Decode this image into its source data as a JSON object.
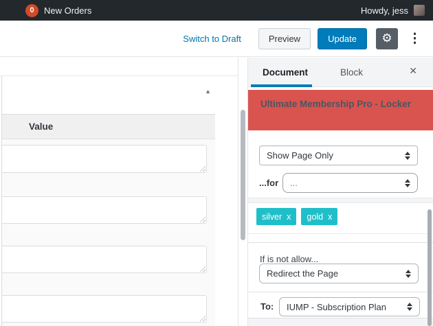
{
  "admin_bar": {
    "orders_badge": "0",
    "orders_label": "New Orders",
    "greeting": "Howdy, jess"
  },
  "editor_header": {
    "switch_to_draft": "Switch to Draft",
    "preview": "Preview",
    "update": "Update"
  },
  "main": {
    "table": {
      "value_header": "Value"
    }
  },
  "sidebar": {
    "tab_document": "Document",
    "tab_block": "Block",
    "panel_title": "Ultimate Membership Pro - Locker",
    "visibility_select_value": "Show Page Only",
    "for_label": "...for",
    "for_select_value": "...",
    "tags": [
      {
        "label": "silver",
        "remove": "x"
      },
      {
        "label": "gold",
        "remove": "x"
      }
    ],
    "not_allow_label": "If is not allow...",
    "action_select_value": "Redirect the Page",
    "to_label": "To:",
    "to_select_value": "IUMP - Subscription Plan"
  },
  "icons": {
    "gear": "⚙",
    "kebab": "⋮",
    "close": "✕",
    "collapse": "▲"
  },
  "colors": {
    "admin_bar_bg": "#23282d",
    "badge": "#d04b28",
    "primary_blue": "#007cba",
    "link_blue": "#0073aa",
    "panel_red": "#d9534f",
    "tag_teal": "#1fbfc9",
    "sidebar_border": "#e2e4e7"
  }
}
